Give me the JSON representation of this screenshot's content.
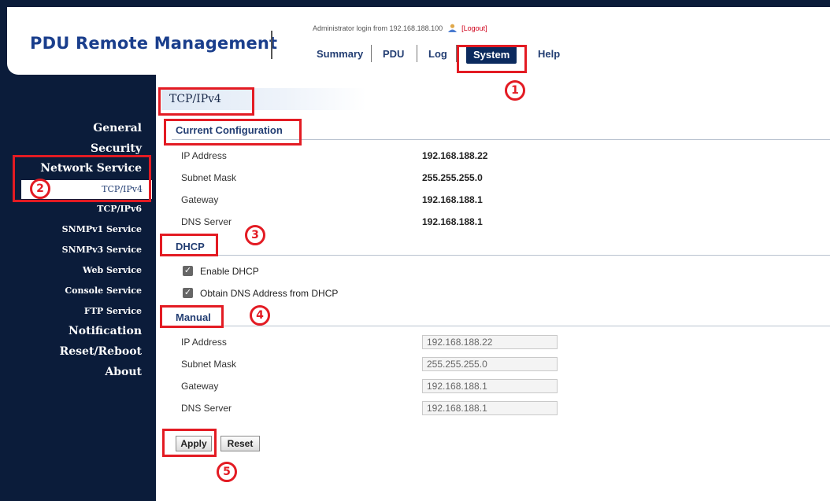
{
  "header": {
    "logo": "PDU Remote Management",
    "login_text": "Administrator login from 192.168.188.100",
    "logout_label": "[Logout]",
    "nav": [
      "Summary",
      "PDU",
      "Log",
      "System",
      "Help"
    ]
  },
  "sidebar": {
    "general": "General",
    "security": "Security",
    "network_service": "Network Service",
    "tcpipv4": "TCP/IPv4",
    "tcpipv6": "TCP/IPv6",
    "snmpv1": "SNMPv1 Service",
    "snmpv3": "SNMPv3 Service",
    "web": "Web Service",
    "console": "Console Service",
    "ftp": "FTP Service",
    "notification": "Notification",
    "reset_reboot": "Reset/Reboot",
    "about": "About"
  },
  "main": {
    "title": "TCP/IPv4",
    "current_config": {
      "heading": "Current Configuration",
      "rows": [
        {
          "label": "IP Address",
          "value": "192.168.188.22"
        },
        {
          "label": "Subnet Mask",
          "value": "255.255.255.0"
        },
        {
          "label": "Gateway",
          "value": "192.168.188.1"
        },
        {
          "label": "DNS Server",
          "value": "192.168.188.1"
        }
      ]
    },
    "dhcp": {
      "heading": "DHCP",
      "enable_label": "Enable DHCP",
      "enable_checked": true,
      "obtain_dns_label": "Obtain DNS Address from DHCP",
      "obtain_dns_checked": true
    },
    "manual": {
      "heading": "Manual",
      "rows": [
        {
          "label": "IP Address",
          "value": "192.168.188.22"
        },
        {
          "label": "Subnet Mask",
          "value": "255.255.255.0"
        },
        {
          "label": "Gateway",
          "value": "192.168.188.1"
        },
        {
          "label": "DNS Server",
          "value": "192.168.188.1"
        }
      ]
    },
    "apply_label": "Apply",
    "reset_label": "Reset"
  },
  "annotations": [
    "1",
    "2",
    "3",
    "4",
    "5"
  ],
  "colors": {
    "annotation": "#e31b23",
    "sidebar_bg": "#0b1c3a",
    "brand": "#1a3e8c",
    "nav_active": "#0b2a5e"
  }
}
